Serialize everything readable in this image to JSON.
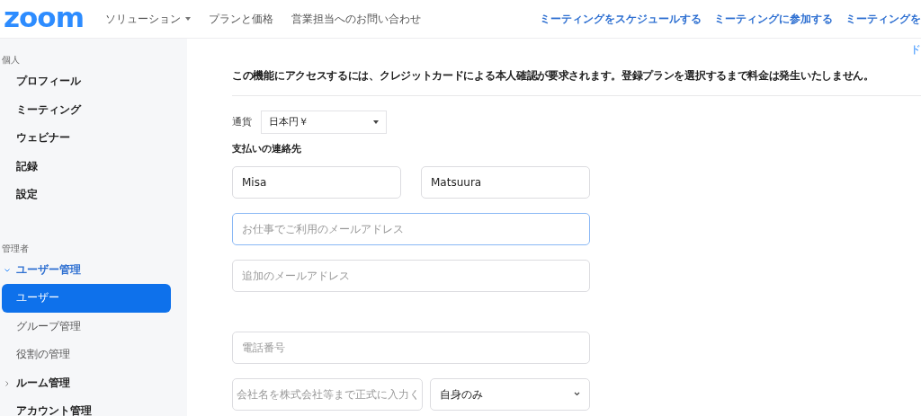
{
  "header": {
    "logo": "zoom",
    "nav": [
      {
        "label": "ソリューション",
        "dropdown": true
      },
      {
        "label": "プランと価格",
        "dropdown": false
      },
      {
        "label": "営業担当へのお問い合わせ",
        "dropdown": false
      }
    ],
    "actions": [
      "ミーティングをスケジュールする",
      "ミーティングに参加する",
      "ミーティングを"
    ]
  },
  "sidebar": {
    "sections": [
      {
        "title": "個人",
        "items": [
          {
            "label": "プロフィール",
            "selected": false
          },
          {
            "label": "ミーティング",
            "selected": false
          },
          {
            "label": "ウェビナー",
            "selected": false
          },
          {
            "label": "記録",
            "selected": false
          },
          {
            "label": "設定",
            "selected": false
          }
        ]
      },
      {
        "title": "管理者",
        "items": [
          {
            "label": "ユーザー管理",
            "selected": false,
            "expanded": true,
            "children": [
              {
                "label": "ユーザー",
                "selected": true
              },
              {
                "label": "グループ管理",
                "selected": false
              },
              {
                "label": "役割の管理",
                "selected": false
              }
            ]
          },
          {
            "label": "ルーム管理",
            "selected": false,
            "expanded": false
          },
          {
            "label": "アカウント管理",
            "selected": false
          }
        ]
      }
    ]
  },
  "main": {
    "corner_link": "ド",
    "notice": "この機能にアクセスするには、クレジットカードによる本人確認が要求されます。登録プランを選択するまで料金は発生いたしません。",
    "currency": {
      "label": "通貨",
      "value": "日本円￥"
    },
    "section_title": "支払いの連絡先",
    "rows": [
      [
        {
          "kind": "input",
          "value": "Misa",
          "focused": false
        },
        {
          "kind": "input",
          "value": "Matsuura",
          "focused": false
        }
      ],
      [
        {
          "kind": "input",
          "placeholder": "お仕事でご利用のメールアドレス",
          "focused": true
        }
      ],
      [
        {
          "kind": "input",
          "placeholder": "追加のメールアドレス",
          "focused": false
        }
      ],
      [
        {
          "kind": "gap"
        }
      ],
      [
        {
          "kind": "input",
          "placeholder": "電話番号",
          "focused": false
        }
      ],
      [
        {
          "kind": "input",
          "placeholder": "会社名を株式会社等まで正式に入力く",
          "focused": false
        },
        {
          "kind": "select",
          "value": "自身のみ"
        }
      ]
    ]
  }
}
